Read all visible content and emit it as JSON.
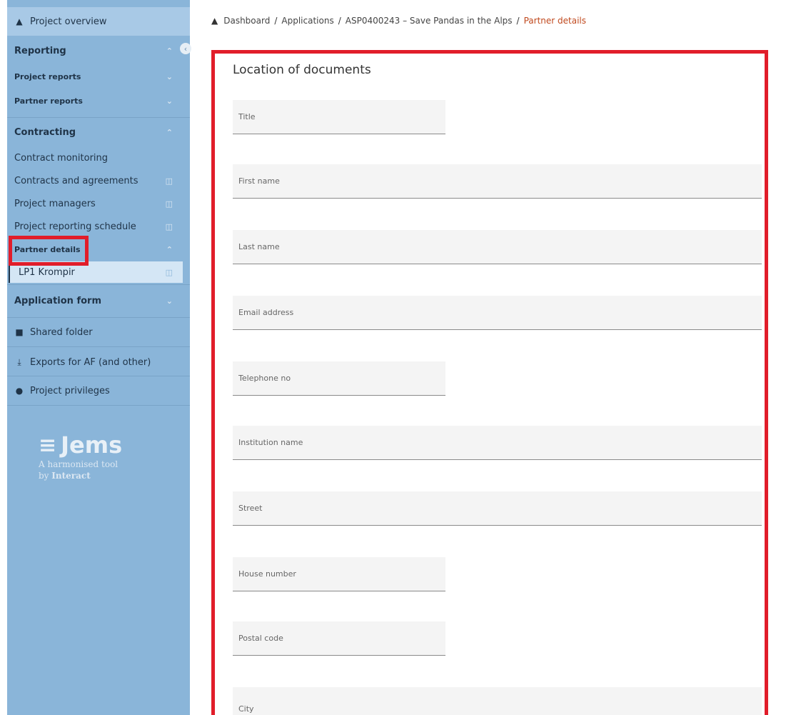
{
  "sidebar": {
    "top_item": "Project overview",
    "reporting": {
      "label": "Reporting",
      "items": [
        "Project reports",
        "Partner reports"
      ]
    },
    "contracting": {
      "label": "Contracting",
      "items": [
        "Contract monitoring",
        "Contracts and agreements",
        "Project managers",
        "Project reporting schedule"
      ],
      "partner_details": "Partner details",
      "partner_sub": "LP1 Krompir"
    },
    "application_form": "Application form",
    "shared_folder": "Shared folder",
    "exports": "Exports for AF (and other)",
    "privileges": "Project privileges",
    "logo": {
      "name": "Jems",
      "line1": "A harmonised tool",
      "line2_prefix": "by ",
      "line2_brand": "Interact"
    }
  },
  "breadcrumb": [
    "Dashboard",
    "Applications",
    "ASP0400243 – Save Pandas in the Alps",
    "Partner details"
  ],
  "main": {
    "section_title": "Location of documents",
    "fields": [
      "Title",
      "First name",
      "Last name",
      "Email address",
      "Telephone no",
      "Institution name",
      "Street",
      "House number",
      "Postal code",
      "City"
    ]
  },
  "colors": {
    "sidebar_bg": "#8ab5d9",
    "highlight": "#e11d2a",
    "breadcrumb_current": "#c0491e"
  }
}
